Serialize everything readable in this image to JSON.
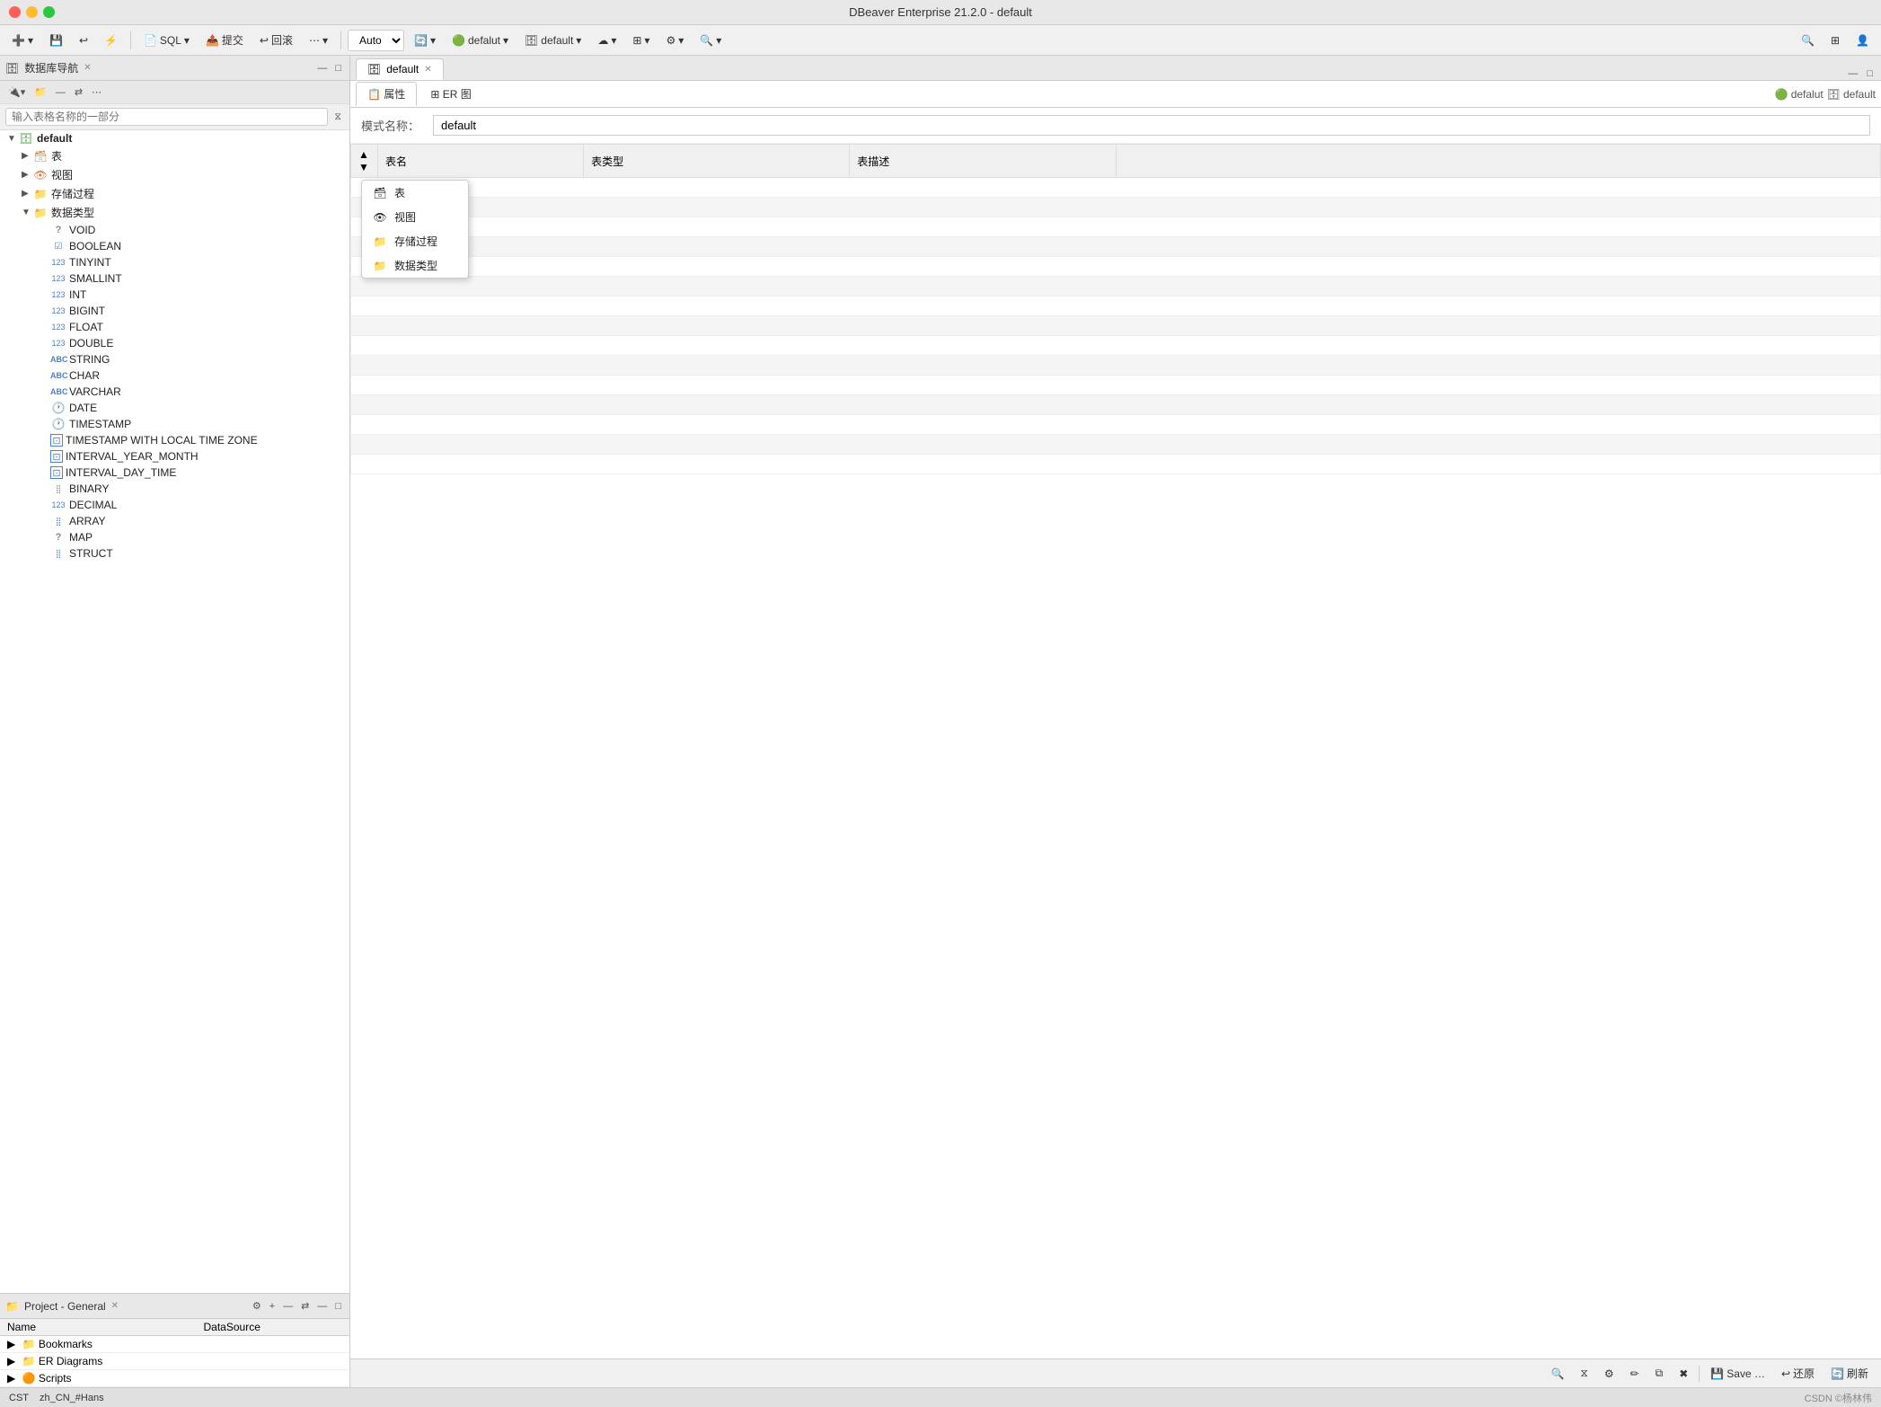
{
  "window": {
    "title": "DBeaver Enterprise 21.2.0 - default",
    "buttons": {
      "close": "close",
      "minimize": "minimize",
      "maximize": "maximize"
    }
  },
  "toolbar": {
    "auto_label": "Auto",
    "connection_label": "defalut",
    "db_label": "default",
    "buttons": [
      "new",
      "save",
      "revert",
      "format",
      "commit",
      "rollback",
      "more"
    ],
    "sql_label": "SQL",
    "submit_label": "提交",
    "rollback_label": "回滚"
  },
  "left_panel": {
    "title": "数据库导航",
    "search_placeholder": "输入表格名称的一部分",
    "tree": {
      "items": [
        {
          "id": "default",
          "label": "default",
          "level": 0,
          "expanded": true,
          "icon": "db",
          "bold": true
        },
        {
          "id": "tables",
          "label": "表",
          "level": 1,
          "expanded": false,
          "icon": "table"
        },
        {
          "id": "views",
          "label": "视图",
          "level": 1,
          "expanded": false,
          "icon": "view"
        },
        {
          "id": "procs",
          "label": "存储过程",
          "level": 1,
          "expanded": false,
          "icon": "proc"
        },
        {
          "id": "datatypes",
          "label": "数据类型",
          "level": 1,
          "expanded": true,
          "icon": "type"
        },
        {
          "id": "VOID",
          "label": "VOID",
          "level": 2,
          "icon": "void"
        },
        {
          "id": "BOOLEAN",
          "label": "BOOLEAN",
          "level": 2,
          "icon": "bool"
        },
        {
          "id": "TINYINT",
          "label": "TINYINT",
          "level": 2,
          "icon": "num"
        },
        {
          "id": "SMALLINT",
          "label": "SMALLINT",
          "level": 2,
          "icon": "num"
        },
        {
          "id": "INT",
          "label": "INT",
          "level": 2,
          "icon": "num"
        },
        {
          "id": "BIGINT",
          "label": "BIGINT",
          "level": 2,
          "icon": "num"
        },
        {
          "id": "FLOAT",
          "label": "FLOAT",
          "level": 2,
          "icon": "num"
        },
        {
          "id": "DOUBLE",
          "label": "DOUBLE",
          "level": 2,
          "icon": "num"
        },
        {
          "id": "STRING",
          "label": "STRING",
          "level": 2,
          "icon": "str"
        },
        {
          "id": "CHAR",
          "label": "CHAR",
          "level": 2,
          "icon": "str"
        },
        {
          "id": "VARCHAR",
          "label": "VARCHAR",
          "level": 2,
          "icon": "str"
        },
        {
          "id": "DATE",
          "label": "DATE",
          "level": 2,
          "icon": "date"
        },
        {
          "id": "TIMESTAMP",
          "label": "TIMESTAMP",
          "level": 2,
          "icon": "date"
        },
        {
          "id": "TIMESTAMP_LTZ",
          "label": "TIMESTAMP WITH LOCAL TIME ZONE",
          "level": 2,
          "icon": "ts"
        },
        {
          "id": "INTERVAL_YM",
          "label": "INTERVAL_YEAR_MONTH",
          "level": 2,
          "icon": "ts"
        },
        {
          "id": "INTERVAL_DT",
          "label": "INTERVAL_DAY_TIME",
          "level": 2,
          "icon": "ts"
        },
        {
          "id": "BINARY",
          "label": "BINARY",
          "level": 2,
          "icon": "bin"
        },
        {
          "id": "DECIMAL",
          "label": "DECIMAL",
          "level": 2,
          "icon": "num"
        },
        {
          "id": "ARRAY",
          "label": "ARRAY",
          "level": 2,
          "icon": "arr"
        },
        {
          "id": "MAP",
          "label": "MAP",
          "level": 2,
          "icon": "void"
        },
        {
          "id": "STRUCT",
          "label": "STRUCT",
          "level": 2,
          "icon": "arr"
        }
      ]
    }
  },
  "right_panel": {
    "tab_label": "default",
    "sub_tabs": [
      {
        "id": "properties",
        "label": "属性"
      },
      {
        "id": "er",
        "label": "ER 图"
      }
    ],
    "schema_label": "模式名称：",
    "schema_value": "default",
    "table_headers": [
      "表名",
      "表类型",
      "表描述"
    ],
    "connection_badge_left": "defalut",
    "connection_badge_right": "default",
    "bottom_buttons": [
      {
        "id": "search",
        "label": "🔍"
      },
      {
        "id": "filter",
        "label": "⧖"
      },
      {
        "id": "settings",
        "label": "⚙"
      },
      {
        "id": "edit",
        "label": "✏"
      },
      {
        "id": "copy",
        "label": "⧉"
      },
      {
        "id": "delete",
        "label": "✖"
      },
      {
        "id": "save",
        "label": "Save …"
      },
      {
        "id": "revert",
        "label": "还原"
      },
      {
        "id": "refresh",
        "label": "刷新"
      }
    ]
  },
  "context_menu": {
    "items": [
      {
        "id": "table",
        "label": "表",
        "icon": "🗃"
      },
      {
        "id": "view",
        "label": "视图",
        "icon": "👁"
      },
      {
        "id": "proc",
        "label": "存储过程",
        "icon": "📁"
      },
      {
        "id": "datatype",
        "label": "数据类型",
        "icon": "📁"
      }
    ]
  },
  "project_panel": {
    "title": "Project - General",
    "columns": [
      "Name",
      "DataSource"
    ],
    "items": [
      {
        "name": "Bookmarks",
        "datasource": "",
        "icon": "📁",
        "type": "bookmarks"
      },
      {
        "name": "ER Diagrams",
        "datasource": "",
        "icon": "📁",
        "type": "er"
      },
      {
        "name": "Scripts",
        "datasource": "",
        "icon": "🟠",
        "type": "scripts"
      }
    ]
  },
  "status_bar": {
    "timezone": "CST",
    "locale": "zh_CN_#Hans",
    "attribution": "CSDN ©杨林伟"
  },
  "icons": {
    "db": "🗄",
    "table": "🗃",
    "view": "👁",
    "proc": "📁",
    "type": "📁",
    "void": "?",
    "bool": "✓",
    "num": "123",
    "str": "ABC",
    "date": "🕐",
    "ts": "⊡",
    "bin": "⣿",
    "arr": "⣿"
  }
}
